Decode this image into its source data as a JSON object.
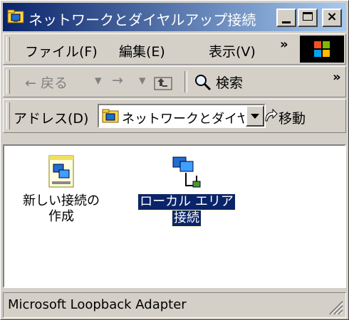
{
  "window": {
    "title": "ネットワークとダイヤルアップ接続",
    "minimize_label": "_",
    "close_label": "×"
  },
  "menubar": {
    "items": [
      "ファイル(F)",
      "編集(E)",
      "表示(V)"
    ],
    "overflow": "»"
  },
  "toolbar": {
    "back_label": "← 戻る",
    "forward_label": "→",
    "search_label": "検索",
    "overflow": "»"
  },
  "address": {
    "label": "アドレス(D)",
    "value": "ネットワークとダイヤ",
    "go_label": "移動"
  },
  "content": {
    "items": [
      {
        "label_line1": "新しい接続の",
        "label_line2": "作成",
        "icon": "new-connection-icon",
        "selected": false
      },
      {
        "label_line1": "ローカル エリア",
        "label_line2": "接続",
        "icon": "lan-connection-icon",
        "selected": true
      }
    ]
  },
  "statusbar": {
    "text": "Microsoft Loopback Adapter"
  },
  "colors": {
    "title_start": "#0a246a",
    "title_end": "#a6caf0",
    "face": "#d4d0c8",
    "selection": "#0a246a"
  }
}
